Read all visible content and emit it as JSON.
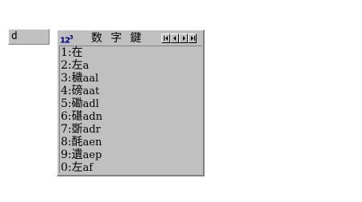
{
  "composition": {
    "text": "d"
  },
  "panel": {
    "logo": {
      "main": "12",
      "sup": "3"
    },
    "title": "数 字 鍵",
    "nav_icons": [
      "first-page-icon",
      "prev-page-icon",
      "next-page-icon",
      "last-page-icon"
    ]
  },
  "candidates": [
    {
      "key": "1",
      "char": "在",
      "code": ""
    },
    {
      "key": "2",
      "char": "左",
      "code": "a"
    },
    {
      "key": "3",
      "char": "穢",
      "code": "aal"
    },
    {
      "key": "4",
      "char": "磅",
      "code": "aat"
    },
    {
      "key": "5",
      "char": "磡",
      "code": "adl"
    },
    {
      "key": "6",
      "char": "碪",
      "code": "adn"
    },
    {
      "key": "7",
      "char": "斲",
      "code": "adr"
    },
    {
      "key": "8",
      "char": "酕",
      "code": "aen"
    },
    {
      "key": "9",
      "char": "遺",
      "code": "aep"
    },
    {
      "key": "0",
      "char": "左",
      "code": "af"
    }
  ]
}
